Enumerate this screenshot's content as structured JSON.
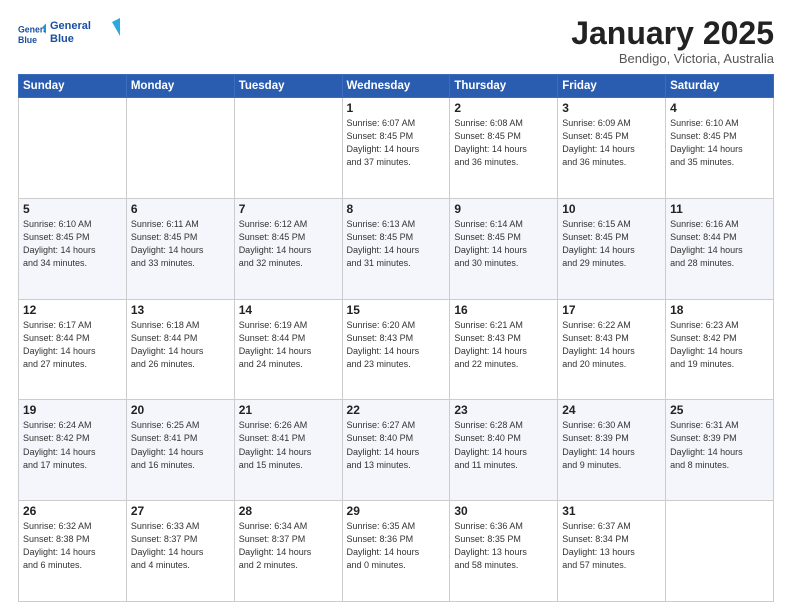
{
  "header": {
    "logo_line1": "General",
    "logo_line2": "Blue",
    "month_title": "January 2025",
    "location": "Bendigo, Victoria, Australia"
  },
  "weekdays": [
    "Sunday",
    "Monday",
    "Tuesday",
    "Wednesday",
    "Thursday",
    "Friday",
    "Saturday"
  ],
  "weeks": [
    [
      {
        "day": "",
        "info": ""
      },
      {
        "day": "",
        "info": ""
      },
      {
        "day": "",
        "info": ""
      },
      {
        "day": "1",
        "info": "Sunrise: 6:07 AM\nSunset: 8:45 PM\nDaylight: 14 hours\nand 37 minutes."
      },
      {
        "day": "2",
        "info": "Sunrise: 6:08 AM\nSunset: 8:45 PM\nDaylight: 14 hours\nand 36 minutes."
      },
      {
        "day": "3",
        "info": "Sunrise: 6:09 AM\nSunset: 8:45 PM\nDaylight: 14 hours\nand 36 minutes."
      },
      {
        "day": "4",
        "info": "Sunrise: 6:10 AM\nSunset: 8:45 PM\nDaylight: 14 hours\nand 35 minutes."
      }
    ],
    [
      {
        "day": "5",
        "info": "Sunrise: 6:10 AM\nSunset: 8:45 PM\nDaylight: 14 hours\nand 34 minutes."
      },
      {
        "day": "6",
        "info": "Sunrise: 6:11 AM\nSunset: 8:45 PM\nDaylight: 14 hours\nand 33 minutes."
      },
      {
        "day": "7",
        "info": "Sunrise: 6:12 AM\nSunset: 8:45 PM\nDaylight: 14 hours\nand 32 minutes."
      },
      {
        "day": "8",
        "info": "Sunrise: 6:13 AM\nSunset: 8:45 PM\nDaylight: 14 hours\nand 31 minutes."
      },
      {
        "day": "9",
        "info": "Sunrise: 6:14 AM\nSunset: 8:45 PM\nDaylight: 14 hours\nand 30 minutes."
      },
      {
        "day": "10",
        "info": "Sunrise: 6:15 AM\nSunset: 8:45 PM\nDaylight: 14 hours\nand 29 minutes."
      },
      {
        "day": "11",
        "info": "Sunrise: 6:16 AM\nSunset: 8:44 PM\nDaylight: 14 hours\nand 28 minutes."
      }
    ],
    [
      {
        "day": "12",
        "info": "Sunrise: 6:17 AM\nSunset: 8:44 PM\nDaylight: 14 hours\nand 27 minutes."
      },
      {
        "day": "13",
        "info": "Sunrise: 6:18 AM\nSunset: 8:44 PM\nDaylight: 14 hours\nand 26 minutes."
      },
      {
        "day": "14",
        "info": "Sunrise: 6:19 AM\nSunset: 8:44 PM\nDaylight: 14 hours\nand 24 minutes."
      },
      {
        "day": "15",
        "info": "Sunrise: 6:20 AM\nSunset: 8:43 PM\nDaylight: 14 hours\nand 23 minutes."
      },
      {
        "day": "16",
        "info": "Sunrise: 6:21 AM\nSunset: 8:43 PM\nDaylight: 14 hours\nand 22 minutes."
      },
      {
        "day": "17",
        "info": "Sunrise: 6:22 AM\nSunset: 8:43 PM\nDaylight: 14 hours\nand 20 minutes."
      },
      {
        "day": "18",
        "info": "Sunrise: 6:23 AM\nSunset: 8:42 PM\nDaylight: 14 hours\nand 19 minutes."
      }
    ],
    [
      {
        "day": "19",
        "info": "Sunrise: 6:24 AM\nSunset: 8:42 PM\nDaylight: 14 hours\nand 17 minutes."
      },
      {
        "day": "20",
        "info": "Sunrise: 6:25 AM\nSunset: 8:41 PM\nDaylight: 14 hours\nand 16 minutes."
      },
      {
        "day": "21",
        "info": "Sunrise: 6:26 AM\nSunset: 8:41 PM\nDaylight: 14 hours\nand 15 minutes."
      },
      {
        "day": "22",
        "info": "Sunrise: 6:27 AM\nSunset: 8:40 PM\nDaylight: 14 hours\nand 13 minutes."
      },
      {
        "day": "23",
        "info": "Sunrise: 6:28 AM\nSunset: 8:40 PM\nDaylight: 14 hours\nand 11 minutes."
      },
      {
        "day": "24",
        "info": "Sunrise: 6:30 AM\nSunset: 8:39 PM\nDaylight: 14 hours\nand 9 minutes."
      },
      {
        "day": "25",
        "info": "Sunrise: 6:31 AM\nSunset: 8:39 PM\nDaylight: 14 hours\nand 8 minutes."
      }
    ],
    [
      {
        "day": "26",
        "info": "Sunrise: 6:32 AM\nSunset: 8:38 PM\nDaylight: 14 hours\nand 6 minutes."
      },
      {
        "day": "27",
        "info": "Sunrise: 6:33 AM\nSunset: 8:37 PM\nDaylight: 14 hours\nand 4 minutes."
      },
      {
        "day": "28",
        "info": "Sunrise: 6:34 AM\nSunset: 8:37 PM\nDaylight: 14 hours\nand 2 minutes."
      },
      {
        "day": "29",
        "info": "Sunrise: 6:35 AM\nSunset: 8:36 PM\nDaylight: 14 hours\nand 0 minutes."
      },
      {
        "day": "30",
        "info": "Sunrise: 6:36 AM\nSunset: 8:35 PM\nDaylight: 13 hours\nand 58 minutes."
      },
      {
        "day": "31",
        "info": "Sunrise: 6:37 AM\nSunset: 8:34 PM\nDaylight: 13 hours\nand 57 minutes."
      },
      {
        "day": "",
        "info": ""
      }
    ]
  ]
}
